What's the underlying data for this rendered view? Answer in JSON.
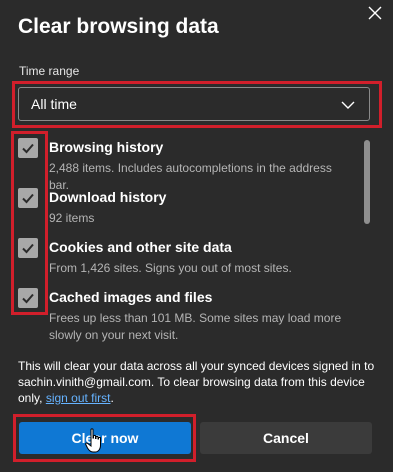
{
  "dialog": {
    "title": "Clear browsing data",
    "close_icon": "close-icon"
  },
  "time_range": {
    "label": "Time range",
    "selected": "All time",
    "chevron_icon": "chevron-down-icon"
  },
  "items": [
    {
      "title": "Browsing history",
      "description": "2,488 items. Includes autocompletions in the address bar.",
      "checked": true
    },
    {
      "title": "Download history",
      "description": "92 items",
      "checked": true
    },
    {
      "title": "Cookies and other site data",
      "description": "From 1,426 sites. Signs you out of most sites.",
      "checked": true
    },
    {
      "title": "Cached images and files",
      "description": "Frees up less than 101 MB. Some sites may load more slowly on your next visit.",
      "checked": true
    }
  ],
  "sync_notice": {
    "text": "This will clear your data across all your synced devices signed in to sachin.vinith@gmail.com. To clear browsing data from this device only,",
    "link": "sign out first",
    "suffix": "."
  },
  "buttons": {
    "clear": "Clear now",
    "cancel": "Cancel"
  },
  "colors": {
    "background": "#2b2b2b",
    "primary": "#0f78d4",
    "highlight": "#d11f2b",
    "link": "#66b3ff"
  }
}
